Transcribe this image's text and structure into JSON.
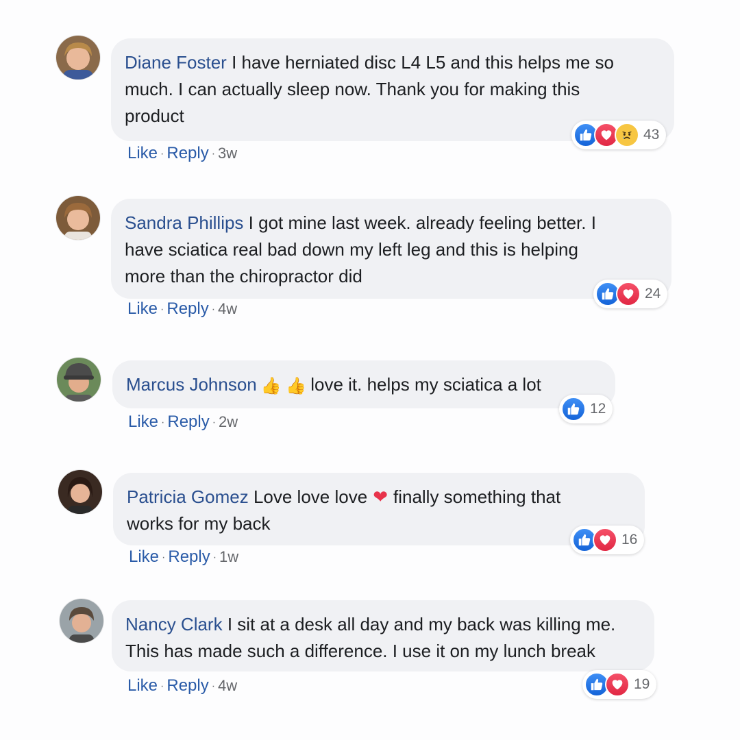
{
  "comments": [
    {
      "author": "Diane Foster",
      "lines": [
        " I have herniated disc L4 L5 and this helps me so",
        "much. I can actually sleep now. Thank you for making this",
        "product"
      ],
      "like": "Like",
      "reply": "Reply",
      "time": "3w",
      "reactions": [
        "like",
        "love",
        "sad"
      ],
      "count": "43"
    },
    {
      "author": "Sandra Phillips",
      "lines": [
        " I got mine last week. already feeling better. I",
        "have sciatica real bad down my left leg and this is helping",
        "more than the chiropractor did"
      ],
      "like": "Like",
      "reply": "Reply",
      "time": "4w",
      "reactions": [
        "like",
        "love"
      ],
      "count": "24"
    },
    {
      "author": "Marcus Johnson",
      "emoji": "👍 👍",
      "lines": [
        "love it. helps my sciatica a lot"
      ],
      "like": "Like",
      "reply": "Reply",
      "time": "2w",
      "reactions": [
        "like"
      ],
      "count": "12"
    },
    {
      "author": "Patricia Gomez",
      "lines": [
        " Love love love",
        "finally something that",
        "works for my back"
      ],
      "heart": "❤",
      "like": "Like",
      "reply": "Reply",
      "time": "1w",
      "reactions": [
        "like",
        "love"
      ],
      "count": "16"
    },
    {
      "author": "Nancy Clark",
      "lines": [
        " I sit at a desk all day and my back was killing me.",
        "This has made such a difference. I use it on my lunch break"
      ],
      "like": "Like",
      "reply": "Reply",
      "time": "4w",
      "reactions": [
        "like",
        "love"
      ],
      "count": "19"
    }
  ],
  "separator": "·",
  "colors": {
    "author": "#2a4f8f",
    "link": "#2a5ba8",
    "bubble": "#f0f1f4",
    "like": "#1463d8",
    "love": "#e12844"
  }
}
